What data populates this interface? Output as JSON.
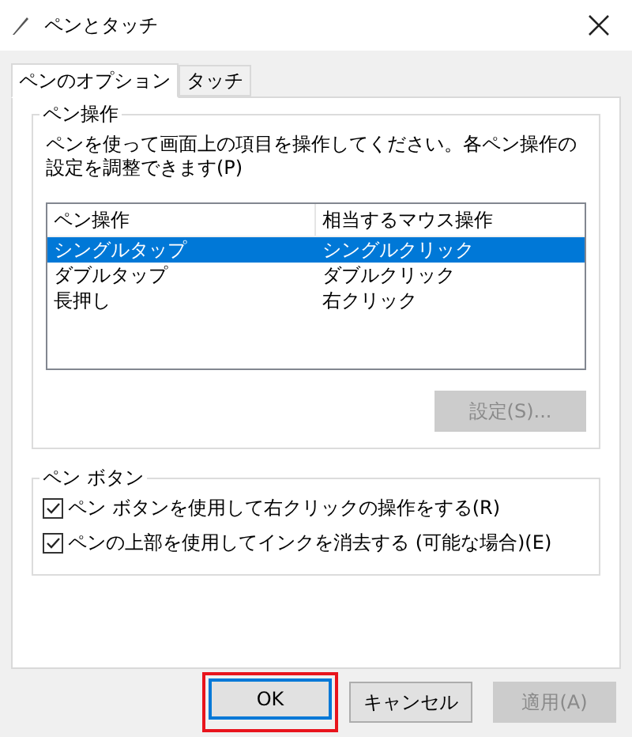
{
  "window": {
    "title": "ペンとタッチ"
  },
  "tabs": [
    {
      "label": "ペンのオプション",
      "selected": true
    },
    {
      "label": "タッチ",
      "selected": false
    }
  ],
  "pen_actions": {
    "title": "ペン操作",
    "description": "ペンを使って画面上の項目を操作してください。各ペン操作の設定を調整できます(P)",
    "columns": [
      "ペン操作",
      "相当するマウス操作"
    ],
    "rows": [
      {
        "cells": [
          "シングルタップ",
          "シングルクリック"
        ],
        "selected": true
      },
      {
        "cells": [
          "ダブルタップ",
          "ダブルクリック"
        ],
        "selected": false
      },
      {
        "cells": [
          "長押し",
          "右クリック"
        ],
        "selected": false
      }
    ],
    "settings_button": {
      "label": "設定(S)...",
      "disabled": true
    }
  },
  "pen_buttons": {
    "title": "ペン ボタン",
    "options": [
      {
        "label": "ペン ボタンを使用して右クリックの操作をする(R)",
        "checked": true
      },
      {
        "label": "ペンの上部を使用してインクを消去する (可能な場合)(E)",
        "checked": true
      }
    ]
  },
  "buttons": [
    {
      "label": "OK",
      "disabled": false,
      "highlighted": true
    },
    {
      "label": "キャンセル",
      "disabled": false,
      "highlighted": false
    },
    {
      "label": "適用(A)",
      "disabled": true,
      "highlighted": false
    }
  ]
}
